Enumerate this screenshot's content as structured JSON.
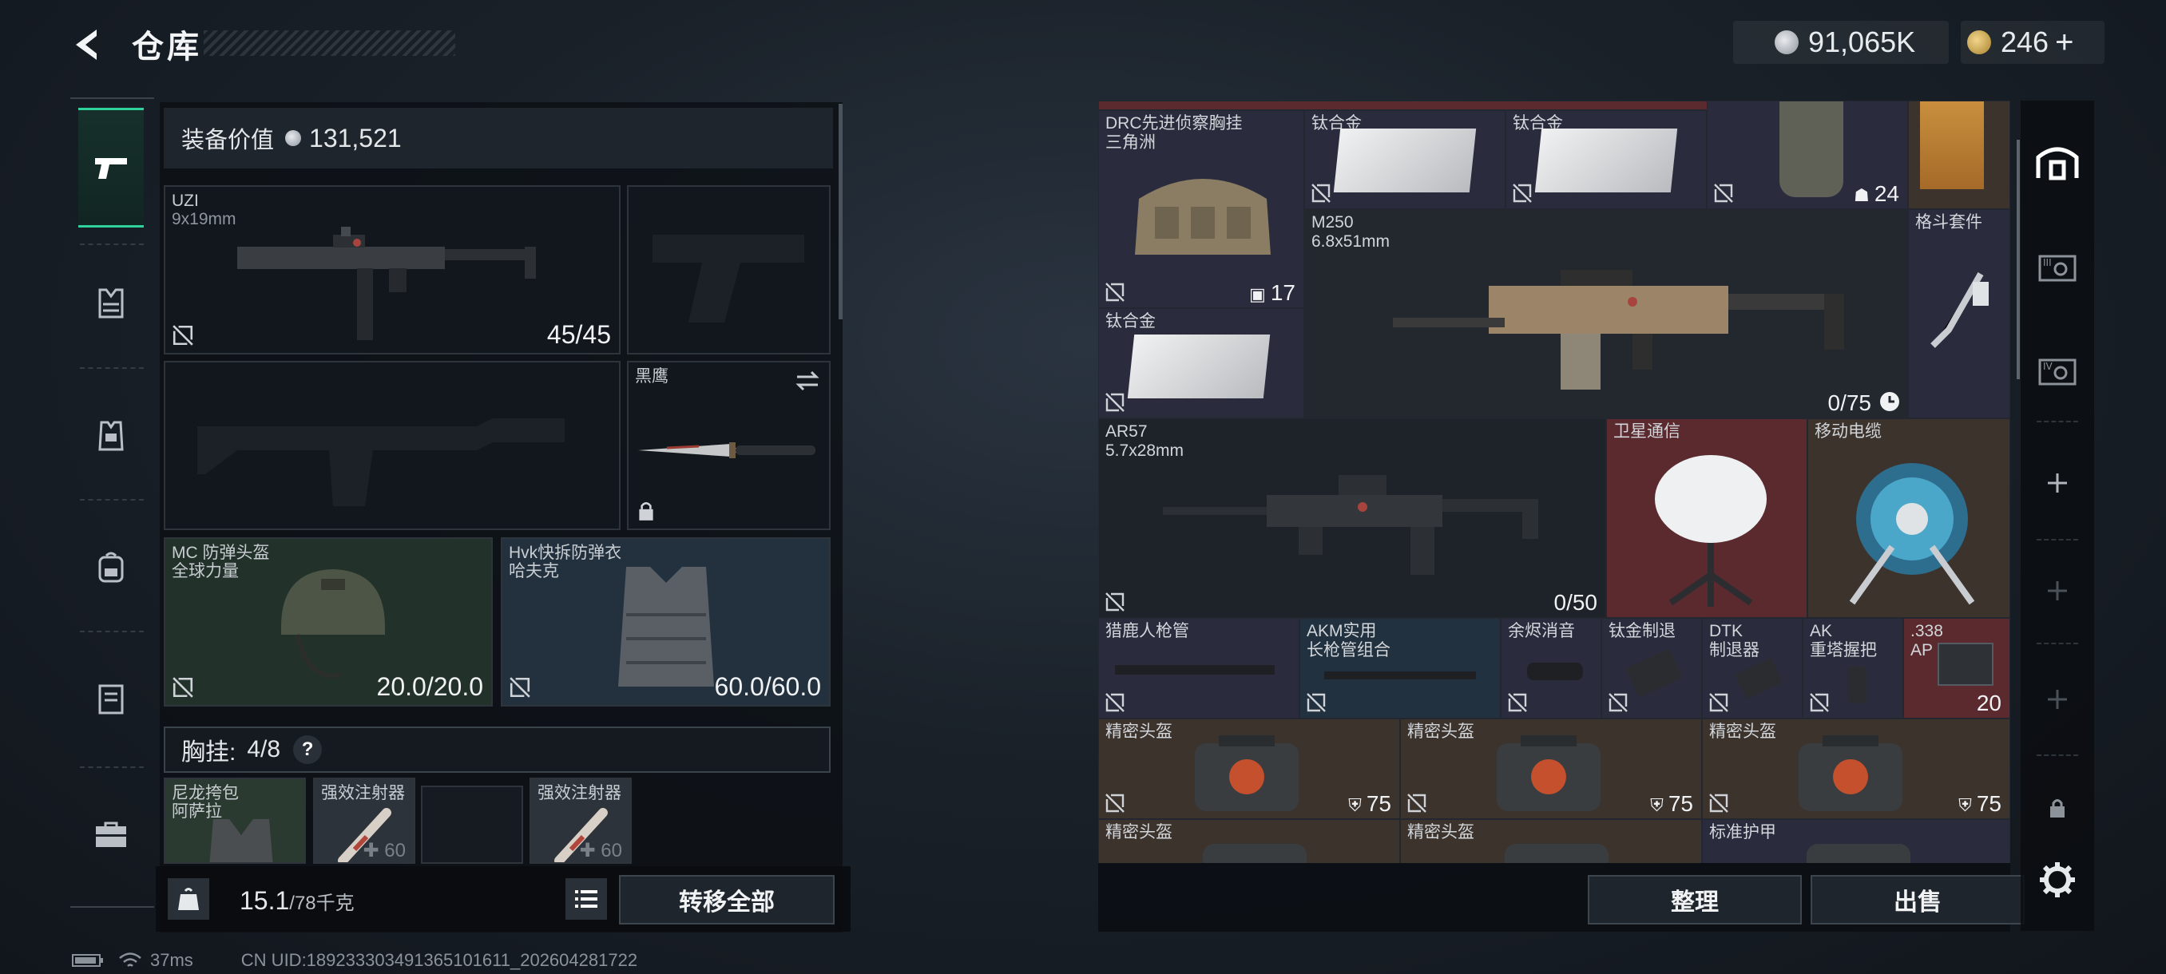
{
  "header": {
    "title": "仓库",
    "currency_silver": "91,065K",
    "currency_gold": "246",
    "gold_plus": "+"
  },
  "loadout": {
    "equip_value_label": "装备价值",
    "equip_value": "131,521",
    "primary": {
      "name": "UZI",
      "caliber": "9x19mm",
      "ammo": "45/45"
    },
    "melee": {
      "name": "黑鹰"
    },
    "helmet": {
      "name": "MC 防弹头盔",
      "brand": "全球力量",
      "durability": "20.0/20.0"
    },
    "armor": {
      "name": "Hvk快拆防弹衣",
      "brand": "哈夫克",
      "durability": "60.0/60.0"
    },
    "chest_label": "胸挂:",
    "chest_value": "4/8",
    "chest_help": "?",
    "chest_items": [
      {
        "name": "尼龙挎包",
        "brand": "阿萨拉"
      },
      {
        "name": "强效注射器",
        "extra": "60"
      },
      {
        "name": ""
      },
      {
        "name": "强效注射器",
        "extra": "60"
      }
    ],
    "weight": "15.1",
    "weight_max": "/78千克",
    "transfer_all": "转移全部"
  },
  "stash": {
    "items": {
      "drc": {
        "name": "DRC先进侦察胸挂",
        "brand": "三角洲",
        "count": "17"
      },
      "ti1": {
        "name": "钛合金"
      },
      "ti2": {
        "name": "钛合金"
      },
      "vest_count": "24",
      "m250": {
        "name": "M250",
        "caliber": "6.8x51mm",
        "ammo": "0/75"
      },
      "melee_kit": {
        "name": "格斗套件"
      },
      "ti3": {
        "name": "钛合金"
      },
      "ar57": {
        "name": "AR57",
        "caliber": "5.7x28mm",
        "ammo": "0/50"
      },
      "sat": {
        "name": "卫星通信"
      },
      "cable": {
        "name": "移动电缆"
      },
      "barrel1": {
        "name": "猎鹿人枪管"
      },
      "barrel2": {
        "name": "AKM实用",
        "sub": "长枪管组合"
      },
      "supp": {
        "name": "余烬消音"
      },
      "muzzle1": {
        "name": "钛金制退"
      },
      "muzzle2": {
        "name": "DTK",
        "sub": "制退器"
      },
      "grip": {
        "name": "AK",
        "sub": "重塔握把"
      },
      "ammo338": {
        "name": ".338",
        "sub": "AP",
        "count": "20"
      },
      "helm1": {
        "name": "精密头盔",
        "value": "75"
      },
      "helm2": {
        "name": "精密头盔",
        "value": "75"
      },
      "helm3": {
        "name": "精密头盔",
        "value": "75"
      },
      "helm4": {
        "name": "精密头盔"
      },
      "helm5": {
        "name": "精密头盔"
      },
      "armor_std": {
        "name": "标准护甲"
      }
    },
    "sort_label": "整理",
    "sell_label": "出售"
  },
  "status": {
    "ping": "37ms",
    "uid": "CN UID:18923330349136510161​1_202604281722"
  },
  "colors": {
    "accent_green": "#2fd29a",
    "rarity_purple": "#2a2c3e",
    "rarity_red": "#5a2a2f",
    "rarity_brown": "#3c332d",
    "rarity_blue": "#22313f"
  }
}
